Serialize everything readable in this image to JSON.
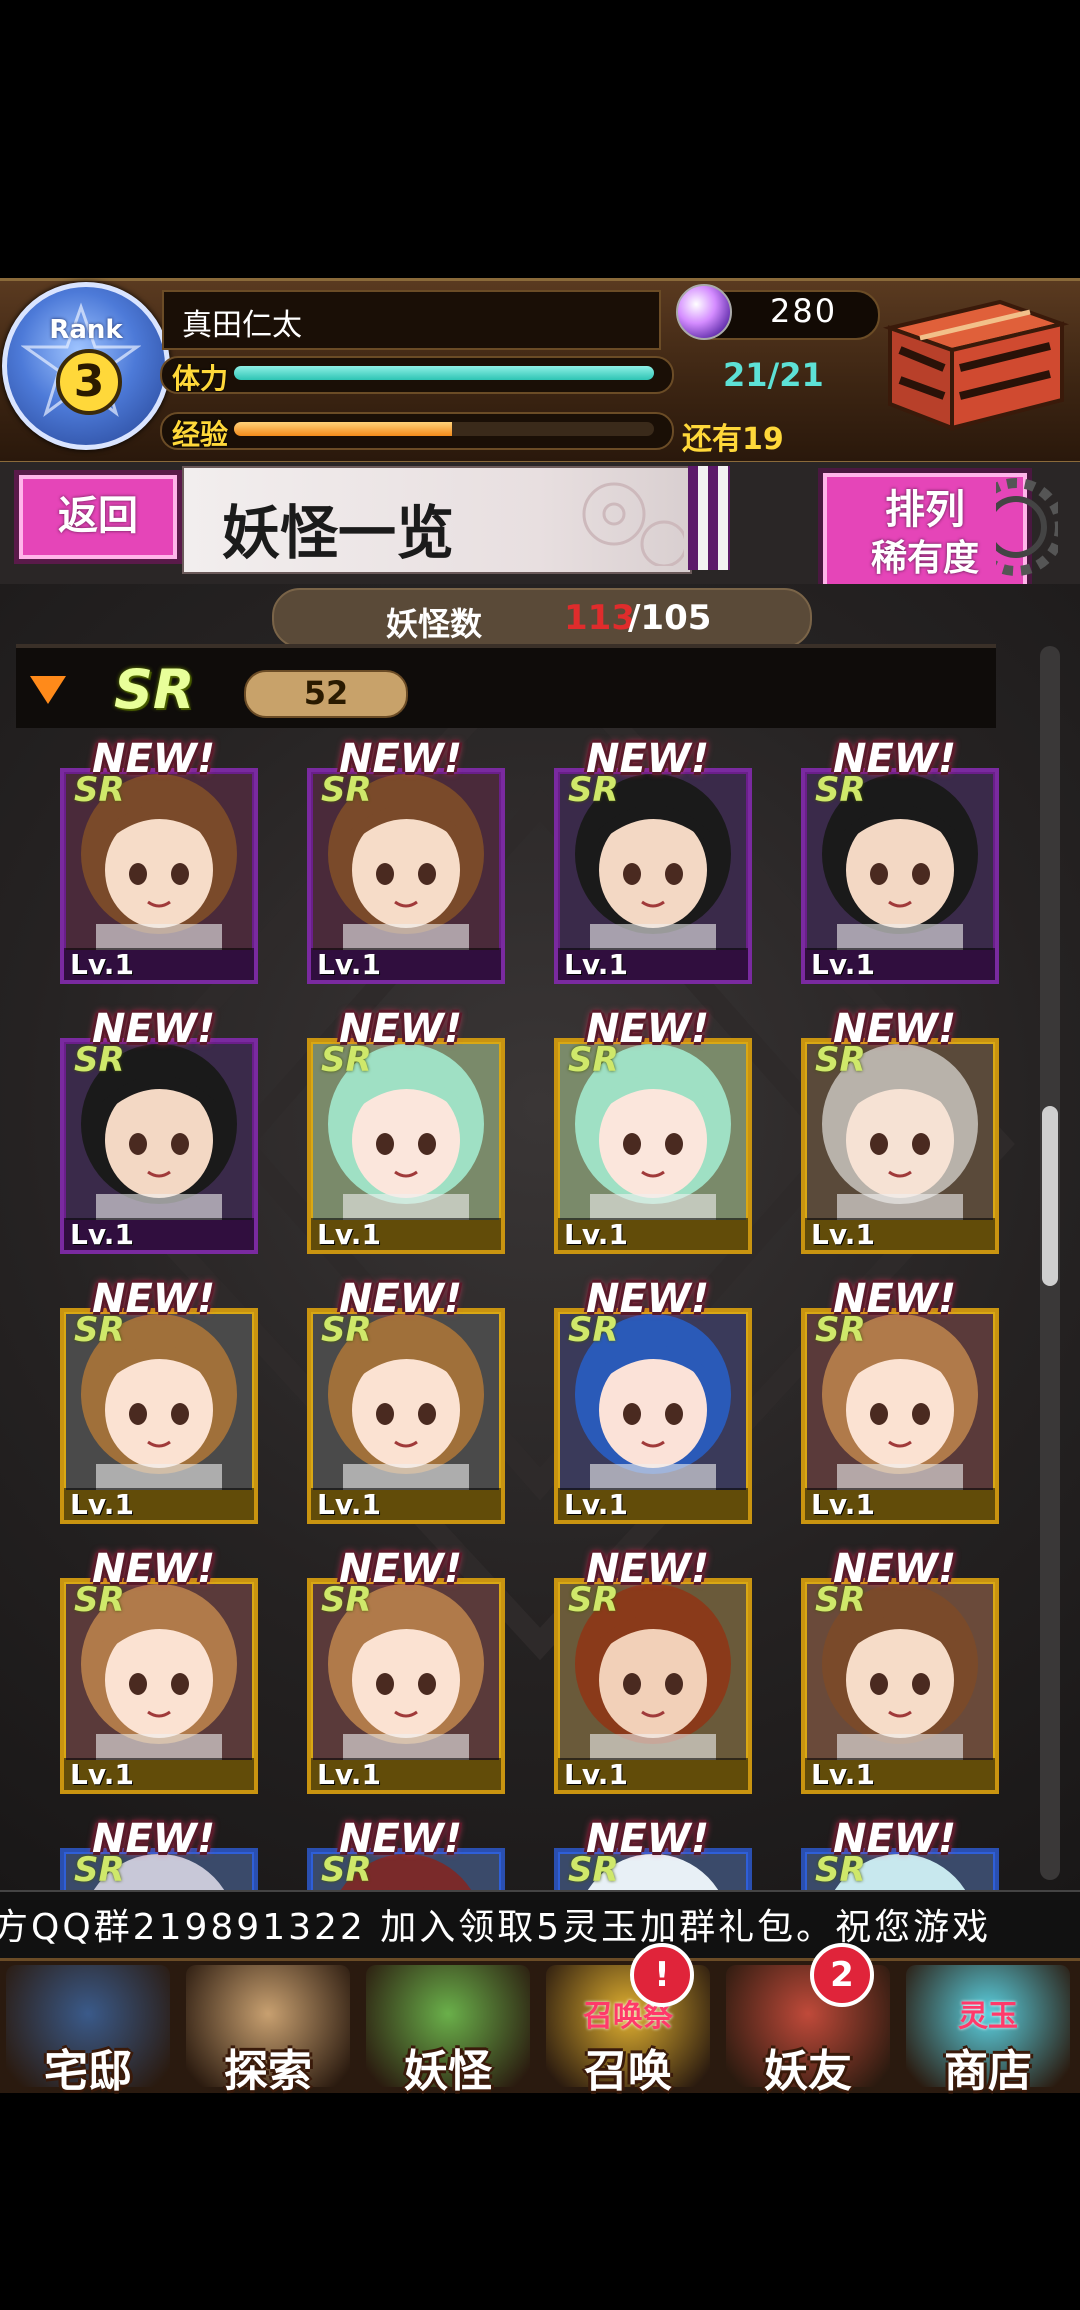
{
  "header": {
    "rank_label": "Rank",
    "rank_value": "3",
    "player_name": "真田仁太",
    "stamina_label": "体力",
    "stamina_value": "21/21",
    "stamina_fraction": 1.0,
    "exp_label": "经验",
    "exp_value": "还有19",
    "exp_fraction": 0.52,
    "gems": "280",
    "gem_icon": "crystal-orb-icon",
    "chest_icon": "gift-chest-icon"
  },
  "title_bar": {
    "back_label": "返回",
    "title": "妖怪一览",
    "sort_title": "排列",
    "sort_value": "稀有度"
  },
  "collection": {
    "count_label": "妖怪数",
    "owned": "113",
    "max": "/105",
    "rarity": "SR",
    "rarity_count": "52"
  },
  "cards": [
    {
      "new": "NEW!",
      "rarity": "SR",
      "level": "Lv.1",
      "frame": "purple",
      "hair": "#7a4a2a",
      "skin": "#f6dcc8",
      "bg": "#4a2a3a"
    },
    {
      "new": "NEW!",
      "rarity": "SR",
      "level": "Lv.1",
      "frame": "purple",
      "hair": "#7a4a2a",
      "skin": "#f6dcc8",
      "bg": "#4a2a3a"
    },
    {
      "new": "NEW!",
      "rarity": "SR",
      "level": "Lv.1",
      "frame": "purple",
      "hair": "#1a1a1a",
      "skin": "#f3d8c4",
      "bg": "#3a2a4a"
    },
    {
      "new": "NEW!",
      "rarity": "SR",
      "level": "Lv.1",
      "frame": "purple",
      "hair": "#1a1a1a",
      "skin": "#f3d8c4",
      "bg": "#3a2a4a"
    },
    {
      "new": "NEW!",
      "rarity": "SR",
      "level": "Lv.1",
      "frame": "purple",
      "hair": "#1a1a1a",
      "skin": "#f3d8c4",
      "bg": "#3a2a4a"
    },
    {
      "new": "NEW!",
      "rarity": "SR",
      "level": "Lv.1",
      "frame": "gold",
      "hair": "#9fe0c4",
      "skin": "#fbe6dc",
      "bg": "#7a8a6a"
    },
    {
      "new": "NEW!",
      "rarity": "SR",
      "level": "Lv.1",
      "frame": "gold",
      "hair": "#9fe0c4",
      "skin": "#fbe6dc",
      "bg": "#7a8a6a"
    },
    {
      "new": "NEW!",
      "rarity": "SR",
      "level": "Lv.1",
      "frame": "gold",
      "hair": "#b8b2aa",
      "skin": "#f6e2d4",
      "bg": "#5a4a3a"
    },
    {
      "new": "NEW!",
      "rarity": "SR",
      "level": "Lv.1",
      "frame": "gold",
      "hair": "#a0703a",
      "skin": "#fbe2d2",
      "bg": "#4a4a4a"
    },
    {
      "new": "NEW!",
      "rarity": "SR",
      "level": "Lv.1",
      "frame": "gold",
      "hair": "#a0703a",
      "skin": "#fbe2d2",
      "bg": "#4a4a4a"
    },
    {
      "new": "NEW!",
      "rarity": "SR",
      "level": "Lv.1",
      "frame": "gold",
      "hair": "#2a5ab8",
      "skin": "#fbe2d8",
      "bg": "#3a3a5a"
    },
    {
      "new": "NEW!",
      "rarity": "SR",
      "level": "Lv.1",
      "frame": "gold",
      "hair": "#b07a4a",
      "skin": "#fbe2d2",
      "bg": "#5a3a3a"
    },
    {
      "new": "NEW!",
      "rarity": "SR",
      "level": "Lv.1",
      "frame": "gold",
      "hair": "#b07a4a",
      "skin": "#fbe2d2",
      "bg": "#5a3a3a"
    },
    {
      "new": "NEW!",
      "rarity": "SR",
      "level": "Lv.1",
      "frame": "gold",
      "hair": "#b07a4a",
      "skin": "#fbe2d2",
      "bg": "#5a3a3a"
    },
    {
      "new": "NEW!",
      "rarity": "SR",
      "level": "Lv.1",
      "frame": "gold",
      "hair": "#8a3a1a",
      "skin": "#f2d0b8",
      "bg": "#6a5a3a"
    },
    {
      "new": "NEW!",
      "rarity": "SR",
      "level": "Lv.1",
      "frame": "gold",
      "hair": "#7a4a2a",
      "skin": "#f6dcc8",
      "bg": "#6a4a3a"
    },
    {
      "new": "NEW!",
      "rarity": "SR",
      "level": "",
      "frame": "blue",
      "hair": "#c8c8d8",
      "skin": "#f3e0d6",
      "bg": "#3a4a6a"
    },
    {
      "new": "NEW!",
      "rarity": "SR",
      "level": "",
      "frame": "blue",
      "hair": "#7a2a2a",
      "skin": "#f6dcc8",
      "bg": "#3a4a6a"
    },
    {
      "new": "NEW!",
      "rarity": "SR",
      "level": "",
      "frame": "blue",
      "hair": "#e8f0f6",
      "skin": "#f6e6e0",
      "bg": "#3a4a6a"
    },
    {
      "new": "NEW!",
      "rarity": "SR",
      "level": "",
      "frame": "blue",
      "hair": "#c8e8ee",
      "skin": "#f6e6e0",
      "bg": "#3a4a6a"
    }
  ],
  "ticker": {
    "text": "方QQ群219891322    加入领取5灵玉加群礼包。祝您游戏"
  },
  "nav": [
    {
      "label": "宅邸",
      "icon": "mansion-icon",
      "color": "#3a5a8a",
      "badge": ""
    },
    {
      "label": "探索",
      "icon": "magnifier-map-icon",
      "color": "#c8a070",
      "badge": ""
    },
    {
      "label": "妖怪",
      "icon": "yokai-scroll-icon",
      "color": "#6ab04a",
      "badge": ""
    },
    {
      "label": "召唤",
      "icon": "summon-festival-icon",
      "color": "#e0b030",
      "badge": "!",
      "sub": "召唤祭"
    },
    {
      "label": "妖友",
      "icon": "friend-girl-icon",
      "color": "#c04a3a",
      "badge": "2"
    },
    {
      "label": "商店",
      "icon": "spirit-orb-icon",
      "color": "#5ad0e0",
      "badge": "",
      "sub": "灵玉"
    }
  ]
}
